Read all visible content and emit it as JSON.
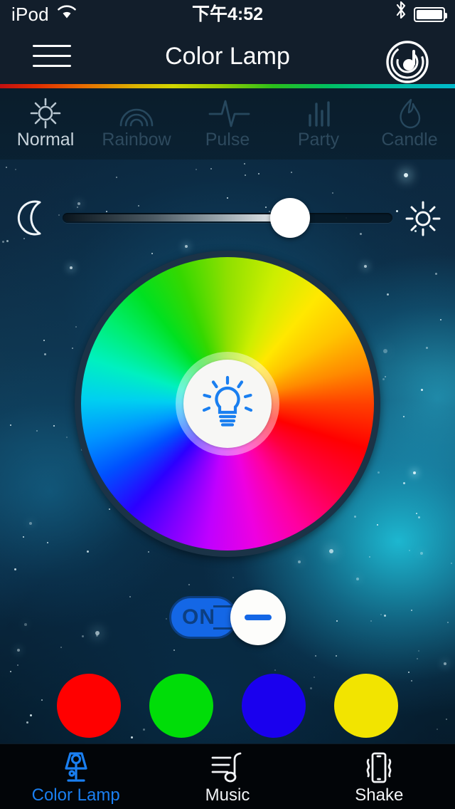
{
  "status_bar": {
    "carrier": "iPod",
    "wifi_icon": "wifi-icon",
    "time": "下午4:52",
    "bluetooth_icon": "bluetooth-icon",
    "battery_icon": "battery-icon"
  },
  "nav_bar": {
    "menu_icon": "hamburger-menu-icon",
    "title": "Color Lamp",
    "music_icon": "music-disc-icon"
  },
  "modes": [
    {
      "label": "Normal",
      "icon": "sun-icon",
      "active": true
    },
    {
      "label": "Rainbow",
      "icon": "rainbow-icon",
      "active": false
    },
    {
      "label": "Pulse",
      "icon": "pulse-icon",
      "active": false
    },
    {
      "label": "Party",
      "icon": "equalizer-icon",
      "active": false
    },
    {
      "label": "Candle",
      "icon": "flame-icon",
      "active": false
    }
  ],
  "brightness": {
    "min_icon": "moon-icon",
    "max_icon": "sun-icon",
    "value_percent": 69
  },
  "color_wheel": {
    "center_icon": "lightbulb-icon",
    "center_icon_color": "#1a7ff0"
  },
  "power_toggle": {
    "state_label": "ON",
    "is_on": true,
    "knob_icon": "minus-icon",
    "track_color": "#1467e6",
    "border_color": "#0c3f82"
  },
  "presets": [
    {
      "name": "red",
      "color": "#FF0000"
    },
    {
      "name": "green",
      "color": "#00DD08"
    },
    {
      "name": "blue",
      "color": "#1A00EE"
    },
    {
      "name": "yellow",
      "color": "#F2E400"
    }
  ],
  "tab_bar": [
    {
      "label": "Color Lamp",
      "icon": "lamp-icon",
      "active": true
    },
    {
      "label": "Music",
      "icon": "music-notes-icon",
      "active": false
    },
    {
      "label": "Shake",
      "icon": "shake-phone-icon",
      "active": false
    }
  ]
}
